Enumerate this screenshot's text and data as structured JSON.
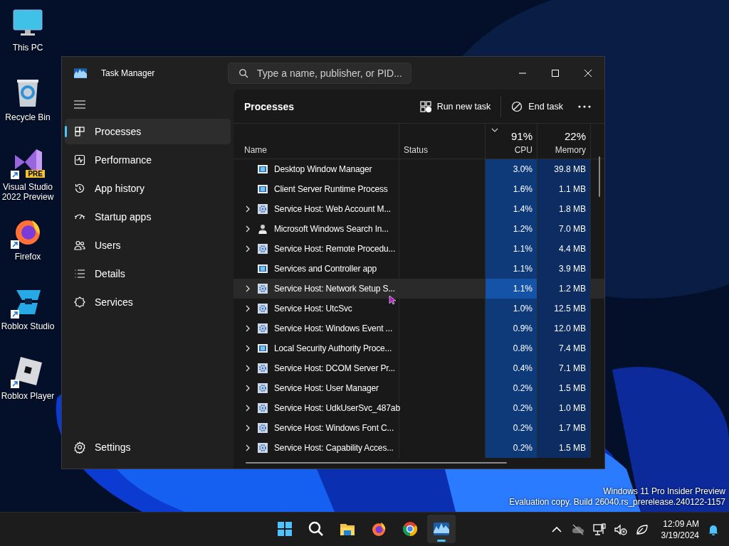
{
  "desktop_icons": [
    {
      "kind": "monitor",
      "label": "This PC",
      "shortcut": false
    },
    {
      "kind": "recycle",
      "label": "Recycle Bin",
      "shortcut": false
    },
    {
      "kind": "vs",
      "label": "Visual Studio 2022 Preview",
      "badge": "PRE",
      "shortcut": true
    },
    {
      "kind": "firefox",
      "label": "Firefox",
      "shortcut": true
    },
    {
      "kind": "studio",
      "label": "Roblox Studio",
      "shortcut": true
    },
    {
      "kind": "player",
      "label": "Roblox Player",
      "shortcut": true
    }
  ],
  "window": {
    "title": "Task Manager",
    "search": {
      "placeholder": "Type a name, publisher, or PID..."
    },
    "nav": [
      {
        "kind": "processes",
        "label": "Processes",
        "selected": true
      },
      {
        "kind": "performance",
        "label": "Performance",
        "selected": false
      },
      {
        "kind": "history",
        "label": "App history",
        "selected": false
      },
      {
        "kind": "startup",
        "label": "Startup apps",
        "selected": false
      },
      {
        "kind": "users",
        "label": "Users",
        "selected": false
      },
      {
        "kind": "details",
        "label": "Details",
        "selected": false
      },
      {
        "kind": "services",
        "label": "Services",
        "selected": false
      }
    ],
    "settings": {
      "label": "Settings"
    },
    "page_title": "Processes",
    "toolbar": [
      {
        "kind": "run",
        "label": "Run new task"
      },
      {
        "kind": "end",
        "label": "End task"
      }
    ],
    "table": {
      "columns": [
        {
          "label": "Name"
        },
        {
          "label": "Status"
        },
        {
          "label": "CPU",
          "total": "91%",
          "sorted": true
        },
        {
          "label": "Memory",
          "total": "22%",
          "sorted": false
        }
      ],
      "rows": [
        {
          "kind": "window",
          "name": "Desktop Window Manager",
          "expandable": false,
          "cpu": "3.0%",
          "memory": "39.8 MB",
          "hovered": false
        },
        {
          "kind": "window",
          "name": "Client Server Runtime Process",
          "expandable": false,
          "cpu": "1.6%",
          "memory": "1.1 MB",
          "hovered": false
        },
        {
          "kind": "service",
          "name": "Service Host: Web Account M...",
          "expandable": true,
          "cpu": "1.4%",
          "memory": "1.8 MB",
          "hovered": false
        },
        {
          "kind": "person",
          "name": "Microsoft Windows Search In...",
          "expandable": true,
          "cpu": "1.2%",
          "memory": "7.0 MB",
          "hovered": false
        },
        {
          "kind": "service",
          "name": "Service Host: Remote Procedu...",
          "expandable": true,
          "cpu": "1.1%",
          "memory": "4.4 MB",
          "hovered": false
        },
        {
          "kind": "window",
          "name": "Services and Controller app",
          "expandable": false,
          "cpu": "1.1%",
          "memory": "3.9 MB",
          "hovered": false
        },
        {
          "kind": "service",
          "name": "Service Host: Network Setup S...",
          "expandable": true,
          "cpu": "1.1%",
          "memory": "1.2 MB",
          "hovered": true
        },
        {
          "kind": "service",
          "name": "Service Host: UtcSvc",
          "expandable": true,
          "cpu": "1.0%",
          "memory": "12.5 MB",
          "hovered": false
        },
        {
          "kind": "service",
          "name": "Service Host: Windows Event ...",
          "expandable": true,
          "cpu": "0.9%",
          "memory": "12.0 MB",
          "hovered": false
        },
        {
          "kind": "window",
          "name": "Local Security Authority Proce...",
          "expandable": true,
          "cpu": "0.8%",
          "memory": "7.4 MB",
          "hovered": false
        },
        {
          "kind": "service",
          "name": "Service Host: DCOM Server Pr...",
          "expandable": true,
          "cpu": "0.4%",
          "memory": "7.1 MB",
          "hovered": false
        },
        {
          "kind": "service",
          "name": "Service Host: User Manager",
          "expandable": true,
          "cpu": "0.2%",
          "memory": "1.5 MB",
          "hovered": false
        },
        {
          "kind": "service",
          "name": "Service Host: UdkUserSvc_487ab",
          "expandable": true,
          "cpu": "0.2%",
          "memory": "1.0 MB",
          "hovered": false
        },
        {
          "kind": "service",
          "name": "Service Host: Windows Font C...",
          "expandable": true,
          "cpu": "0.2%",
          "memory": "1.7 MB",
          "hovered": false
        },
        {
          "kind": "service",
          "name": "Service Host: Capability Acces...",
          "expandable": true,
          "cpu": "0.2%",
          "memory": "1.5 MB",
          "hovered": false
        }
      ]
    }
  },
  "watermark_lines": [
    "Windows 11 Pro Insider Preview",
    "Evaluation copy. Build 26040.rs_prerelease.240122-1157"
  ],
  "taskbar": {
    "apps": [
      {
        "kind": "start",
        "active": false
      },
      {
        "kind": "search",
        "active": false
      },
      {
        "kind": "explorer",
        "active": false
      },
      {
        "kind": "firefox",
        "active": false
      },
      {
        "kind": "chrome",
        "active": false
      },
      {
        "kind": "taskmgr",
        "active": true
      }
    ],
    "tray": [
      {
        "kind": "chevron"
      },
      {
        "kind": "cloud"
      },
      {
        "kind": "network"
      },
      {
        "kind": "volume"
      },
      {
        "kind": "leaf"
      }
    ],
    "time": "12:09 AM",
    "date": "3/19/2024"
  }
}
